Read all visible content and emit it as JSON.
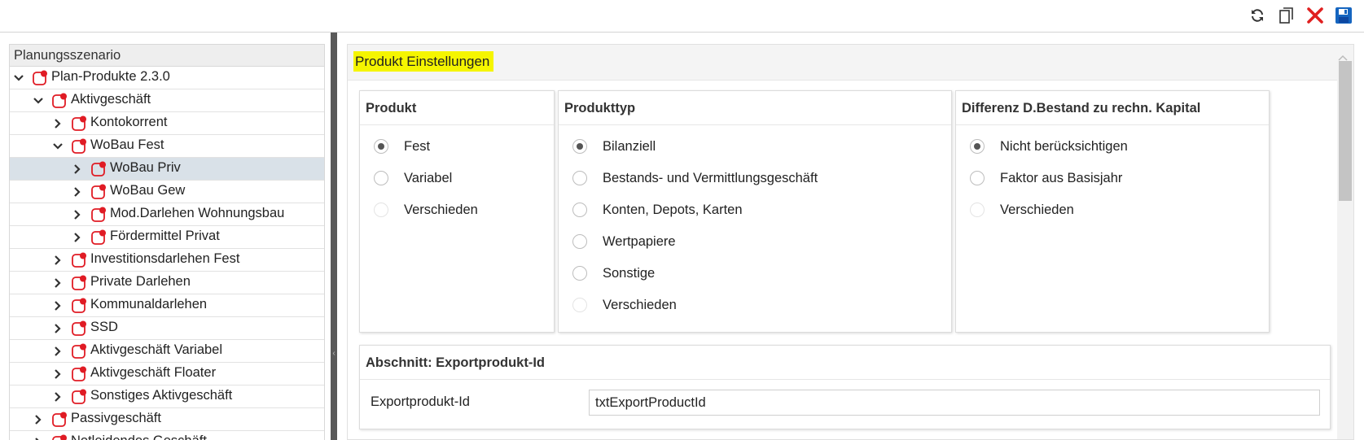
{
  "toolbar": {
    "icons": [
      "refresh-icon",
      "copy-icon",
      "close-icon",
      "save-icon"
    ],
    "colors": {
      "refresh": "#333333",
      "copy": "#333333",
      "close": "#e02020",
      "save": "#1565c0"
    }
  },
  "tree": {
    "header": "Planungsszenario",
    "items": [
      {
        "label": "Plan-Produkte 2.3.0",
        "expanded": true,
        "level": 0
      },
      {
        "label": "Aktivgeschäft",
        "expanded": true,
        "level": 1
      },
      {
        "label": "Kontokorrent",
        "expanded": false,
        "level": 2
      },
      {
        "label": "WoBau Fest",
        "expanded": true,
        "level": 2
      },
      {
        "label": "WoBau Priv",
        "expanded": false,
        "level": 3,
        "selected": true
      },
      {
        "label": "WoBau Gew",
        "expanded": false,
        "level": 3
      },
      {
        "label": "Mod.Darlehen Wohnungsbau",
        "expanded": false,
        "level": 3
      },
      {
        "label": "Fördermittel Privat",
        "expanded": false,
        "level": 3
      },
      {
        "label": "Investitionsdarlehen Fest",
        "expanded": false,
        "level": 2
      },
      {
        "label": "Private Darlehen",
        "expanded": false,
        "level": 2
      },
      {
        "label": "Kommunaldarlehen",
        "expanded": false,
        "level": 2
      },
      {
        "label": "SSD",
        "expanded": false,
        "level": 2
      },
      {
        "label": "Aktivgeschäft Variabel",
        "expanded": false,
        "level": 2
      },
      {
        "label": "Aktivgeschäft Floater",
        "expanded": false,
        "level": 2
      },
      {
        "label": "Sonstiges Aktivgeschäft",
        "expanded": false,
        "level": 2
      },
      {
        "label": "Passivgeschäft",
        "expanded": false,
        "level": 1
      },
      {
        "label": "Notleidendes Geschäft",
        "expanded": false,
        "level": 1
      }
    ],
    "icon_color": "#e01b24"
  },
  "section": {
    "title": "Produkt Einstellungen",
    "highlight_color": "#f5f500"
  },
  "cards": [
    {
      "title": "Produkt",
      "options": [
        {
          "label": "Fest",
          "checked": true,
          "disabled": false
        },
        {
          "label": "Variabel",
          "checked": false,
          "disabled": false
        },
        {
          "label": "Verschieden",
          "checked": false,
          "disabled": true
        }
      ]
    },
    {
      "title": "Produkttyp",
      "options": [
        {
          "label": "Bilanziell",
          "checked": true,
          "disabled": false
        },
        {
          "label": "Bestands- und Vermittlungsgeschäft",
          "checked": false,
          "disabled": false
        },
        {
          "label": "Konten, Depots, Karten",
          "checked": false,
          "disabled": false
        },
        {
          "label": "Wertpapiere",
          "checked": false,
          "disabled": false
        },
        {
          "label": "Sonstige",
          "checked": false,
          "disabled": false
        },
        {
          "label": "Verschieden",
          "checked": false,
          "disabled": true
        }
      ]
    },
    {
      "title": "Differenz D.Bestand zu rechn. Kapital",
      "options": [
        {
          "label": "Nicht berücksichtigen",
          "checked": true,
          "disabled": false
        },
        {
          "label": "Faktor aus Basisjahr",
          "checked": false,
          "disabled": false
        },
        {
          "label": "Verschieden",
          "checked": false,
          "disabled": true
        }
      ]
    }
  ],
  "export": {
    "title": "Abschnitt: Exportprodukt-Id",
    "label": "Exportprodukt-Id",
    "value": "txtExportProductId"
  }
}
